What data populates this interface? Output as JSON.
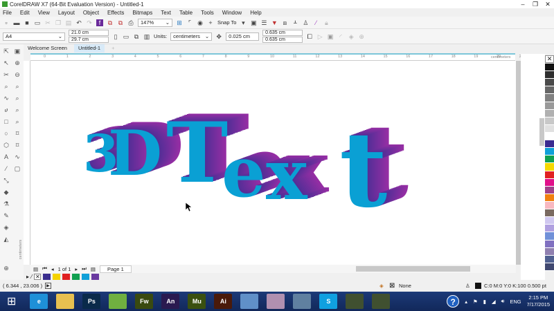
{
  "window": {
    "title": "CorelDRAW X7 (64-Bit Evaluation Version) - Untitled-1",
    "minimize": "–",
    "restore": "❐",
    "close": "✕"
  },
  "menu": [
    "File",
    "Edit",
    "View",
    "Layout",
    "Object",
    "Effects",
    "Bitmaps",
    "Text",
    "Table",
    "Tools",
    "Window",
    "Help"
  ],
  "toolbar": {
    "zoom": "147%",
    "snap_to": "Snap To"
  },
  "propbar": {
    "page_size": "A4",
    "width": "21.0 cm",
    "height": "29.7 cm",
    "units_label": "Units:",
    "units": "centimeters",
    "nudge": "0.025 cm",
    "dup_x": "0.635 cm",
    "dup_y": "0.635 cm"
  },
  "tabs": [
    "Welcome Screen",
    "Untitled-1"
  ],
  "ruler": {
    "unit": "centimeters",
    "ticks": [
      "0",
      "1",
      "2",
      "3",
      "4",
      "5",
      "6",
      "7",
      "8",
      "9",
      "10",
      "11",
      "12",
      "13",
      "14",
      "15",
      "16",
      "17",
      "18",
      "19",
      "20",
      "21"
    ],
    "vertical_label": "centimeters"
  },
  "artwork": {
    "letters": [
      "3",
      "D",
      "T",
      "e",
      "x",
      "t"
    ],
    "face_color": "#0aa0d4",
    "extrude_color": "#5a2e9a"
  },
  "pagenav": {
    "count": "1 of 1",
    "page_tab": "Page 1"
  },
  "doc_palette": [
    "#3a2e8e",
    "#f5d200",
    "#e02020",
    "#10a050",
    "#10a0d8",
    "#6a3aa0"
  ],
  "palette": [
    "#111111",
    "#2e2e2e",
    "#4a4a4a",
    "#666666",
    "#808080",
    "#999999",
    "#b0b0b0",
    "#c8c8c8",
    "#e0e0e0",
    "#ffffff",
    "#3a2a90",
    "#10a0d8",
    "#10a050",
    "#f5d800",
    "#e02020",
    "#e0108a",
    "#a0408a",
    "#f08010",
    "#f8b8c0",
    "#7a6a60",
    "#d0c8f0",
    "#b0a0e0",
    "#7090d8",
    "#8070c0",
    "#9080b0",
    "#506090",
    "#404870"
  ],
  "status": {
    "coords": "( 6.344 , 23.006 )",
    "fill": "None",
    "outline": "C:0 M:0 Y:0 K:100  0.500 pt"
  },
  "taskbar": {
    "apps": [
      {
        "name": "ie",
        "label": "e",
        "color": "#1e90d8"
      },
      {
        "name": "explorer",
        "label": "",
        "color": "#e8c050"
      },
      {
        "name": "photoshop",
        "label": "Ps",
        "color": "#0a2a4a"
      },
      {
        "name": "coreldraw",
        "label": "",
        "color": "#70b040"
      },
      {
        "name": "fireworks",
        "label": "Fw",
        "color": "#3a4a10"
      },
      {
        "name": "animate",
        "label": "An",
        "color": "#2a1a50"
      },
      {
        "name": "muse",
        "label": "Mu",
        "color": "#3a5010"
      },
      {
        "name": "illustrator",
        "label": "Ai",
        "color": "#4a1a0a"
      },
      {
        "name": "notepad",
        "label": "",
        "color": "#6090c8"
      },
      {
        "name": "snipping",
        "label": "",
        "color": "#b090b0"
      },
      {
        "name": "calculator",
        "label": "",
        "color": "#6080a0"
      },
      {
        "name": "skype",
        "label": "S",
        "color": "#10a0e0"
      },
      {
        "name": "app1",
        "label": "",
        "color": "#405030"
      },
      {
        "name": "app2",
        "label": "",
        "color": "#405030"
      }
    ],
    "lang": "ENG",
    "time": "2:15 PM",
    "date": "7/17/2015"
  }
}
